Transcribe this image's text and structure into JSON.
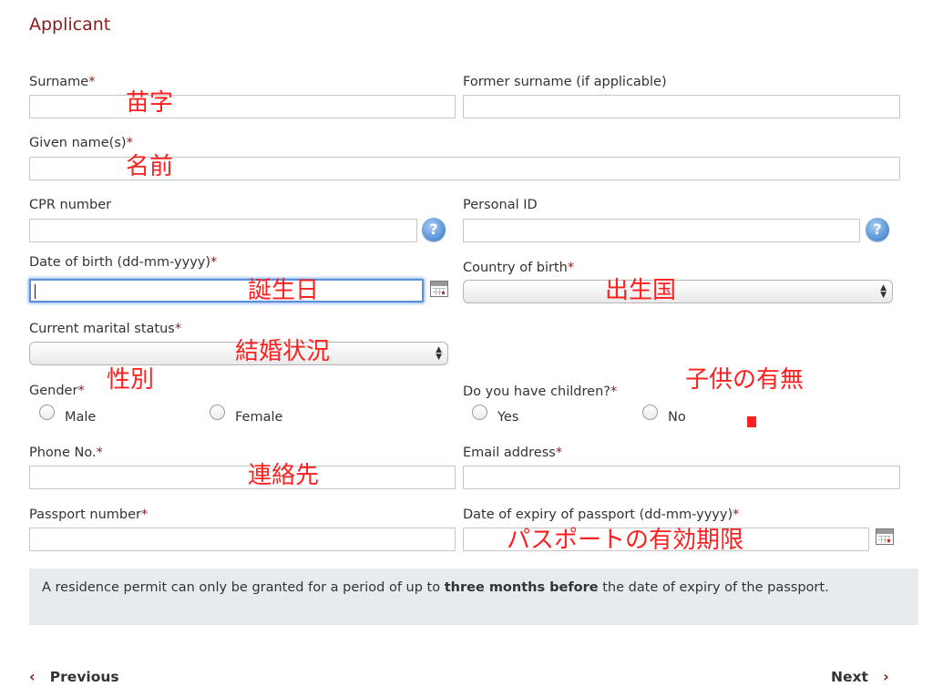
{
  "section_title": "Applicant",
  "required_mark": "*",
  "fields": {
    "surname": {
      "label": "Surname",
      "value": ""
    },
    "former_surname": {
      "label": "Former surname (if applicable)",
      "value": ""
    },
    "given_names": {
      "label": "Given name(s)",
      "value": ""
    },
    "cpr_number": {
      "label": "CPR number",
      "value": ""
    },
    "personal_id": {
      "label": "Personal ID",
      "value": ""
    },
    "date_of_birth": {
      "label": "Date of birth (dd-mm-yyyy)",
      "value": ""
    },
    "country_of_birth": {
      "label": "Country of birth",
      "value": ""
    },
    "marital_status": {
      "label": "Current marital status",
      "value": ""
    },
    "gender": {
      "label": "Gender",
      "options": [
        "Male",
        "Female"
      ]
    },
    "children": {
      "label": "Do you have children?",
      "options": [
        "Yes",
        "No"
      ]
    },
    "phone": {
      "label": "Phone No.",
      "value": ""
    },
    "email": {
      "label": "Email address",
      "value": ""
    },
    "passport_number": {
      "label": "Passport number",
      "value": ""
    },
    "passport_expiry": {
      "label": "Date of expiry of passport (dd-mm-yyyy)",
      "value": ""
    }
  },
  "help_glyph": "?",
  "notice": {
    "before": "A residence permit can only be granted for a period of up to ",
    "bold": "three months before",
    "after": " the date of expiry of the passport."
  },
  "nav": {
    "previous_label": "Previous",
    "next_label": "Next",
    "prev_chevron": "‹",
    "next_chevron": "›"
  },
  "annotations": {
    "surname": "苗字",
    "given_names": "名前",
    "date_of_birth": "誕生日",
    "country_of_birth": "出生国",
    "marital_status": "結婚状況",
    "gender": "性別",
    "children": "子供の有無",
    "phone": "連絡先",
    "passport_expiry": "パスポートの有効期限"
  },
  "colors": {
    "accent": "#8b1a1a",
    "annotation": "#ff1f1f",
    "notice_bg": "#e7ebee"
  }
}
